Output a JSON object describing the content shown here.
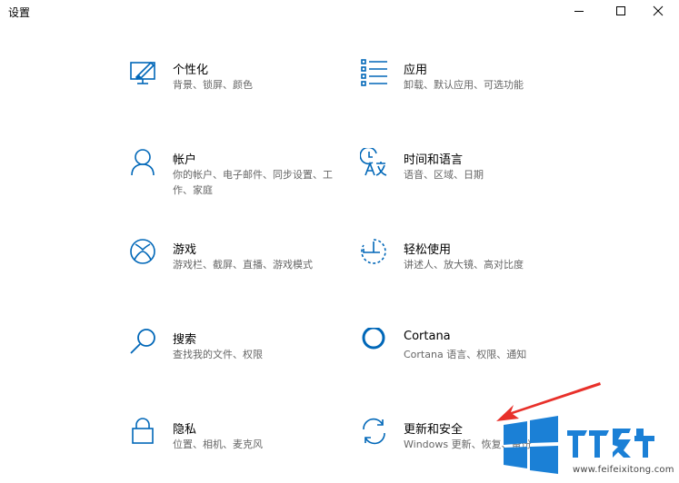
{
  "window": {
    "title": "设置",
    "minimize_icon": "minimize-icon",
    "maximize_icon": "maximize-icon",
    "close_icon": "close-icon"
  },
  "tiles": [
    {
      "name": "个性化",
      "desc": "背景、锁屏、颜色",
      "icon": "personalization-icon"
    },
    {
      "name": "应用",
      "desc": "卸载、默认应用、可选功能",
      "icon": "apps-icon"
    },
    {
      "name": "帐户",
      "desc": "你的帐户、电子邮件、同步设置、工作、家庭",
      "icon": "accounts-icon"
    },
    {
      "name": "时间和语言",
      "desc": "语音、区域、日期",
      "icon": "time-language-icon"
    },
    {
      "name": "游戏",
      "desc": "游戏栏、截屏、直播、游戏模式",
      "icon": "gaming-icon"
    },
    {
      "name": "轻松使用",
      "desc": "讲述人、放大镜、高对比度",
      "icon": "ease-of-access-icon"
    },
    {
      "name": "搜索",
      "desc": "查找我的文件、权限",
      "icon": "search-icon"
    },
    {
      "name": "Cortana",
      "desc": "Cortana 语言、权限、通知",
      "icon": "cortana-icon"
    },
    {
      "name": "隐私",
      "desc": "位置、相机、麦克风",
      "icon": "lock-icon"
    },
    {
      "name": "更新和安全",
      "desc": "Windows 更新、恢复、备份",
      "icon": "update-icon"
    }
  ],
  "watermark": {
    "brand": "飞飞系统",
    "site": "www.feifeixitong.com"
  },
  "colors": {
    "accent": "#0067b8",
    "arrow": "#e8302a"
  }
}
